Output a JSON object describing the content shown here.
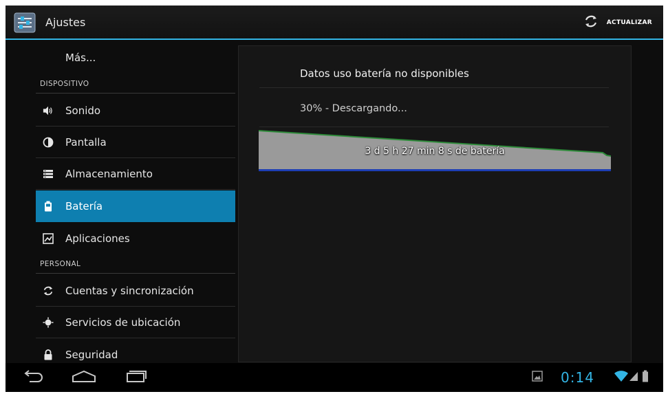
{
  "action_bar": {
    "title": "Ajustes",
    "refresh_label": "ACTUALIZAR"
  },
  "sidebar": {
    "more_label": "Más...",
    "section_device": "DISPOSITIVO",
    "section_personal": "PERSONAL",
    "items": [
      {
        "label": "Sonido",
        "icon": "speaker-icon"
      },
      {
        "label": "Pantalla",
        "icon": "brightness-icon"
      },
      {
        "label": "Almacenamiento",
        "icon": "storage-icon"
      },
      {
        "label": "Batería",
        "icon": "battery-icon",
        "selected": true
      },
      {
        "label": "Aplicaciones",
        "icon": "apps-icon"
      },
      {
        "label": "Cuentas y sincronización",
        "icon": "sync-icon"
      },
      {
        "label": "Servicios de ubicación",
        "icon": "location-icon"
      },
      {
        "label": "Seguridad",
        "icon": "lock-icon"
      }
    ]
  },
  "battery": {
    "no_data": "Datos uso batería no disponibles",
    "status": "30% - Descargando...",
    "graph_label": "3 d 5 h 27 min 8 s de batería"
  },
  "status_bar": {
    "clock": "0:14"
  },
  "colors": {
    "accent": "#33b5e5",
    "selected": "#0e7fb0",
    "graph_fill": "#9a9a9a",
    "graph_line": "#2e8b3a",
    "graph_base": "#1e3fb5"
  }
}
